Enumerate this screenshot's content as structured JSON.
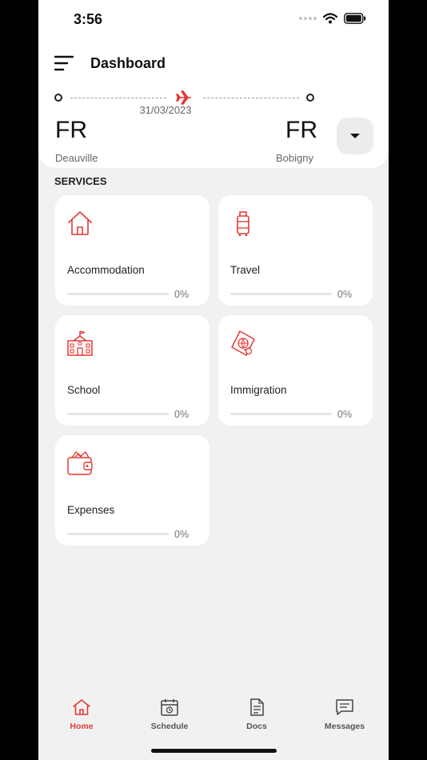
{
  "status_bar": {
    "time": "3:56"
  },
  "header": {
    "title": "Dashboard",
    "date": "31/03/2023",
    "origin": {
      "code": "FR",
      "city": "Deauville"
    },
    "destination": {
      "code": "FR",
      "city": "Bobigny"
    }
  },
  "services": {
    "section_label": "SERVICES",
    "items": [
      {
        "label": "Accommodation",
        "progress": "0%",
        "icon": "house-icon"
      },
      {
        "label": "Travel",
        "progress": "0%",
        "icon": "luggage-icon"
      },
      {
        "label": "School",
        "progress": "0%",
        "icon": "school-building-icon"
      },
      {
        "label": "Immigration",
        "progress": "0%",
        "icon": "passport-icon"
      },
      {
        "label": "Expenses",
        "progress": "0%",
        "icon": "wallet-icon"
      }
    ]
  },
  "tabs": [
    {
      "label": "Home",
      "icon": "home-icon",
      "active": true
    },
    {
      "label": "Schedule",
      "icon": "calendar-icon",
      "active": false
    },
    {
      "label": "Docs",
      "icon": "document-icon",
      "active": false
    },
    {
      "label": "Messages",
      "icon": "chat-icon",
      "active": false
    }
  ],
  "colors": {
    "accent": "#e53935",
    "background": "#f1f1f1",
    "card": "#ffffff"
  }
}
